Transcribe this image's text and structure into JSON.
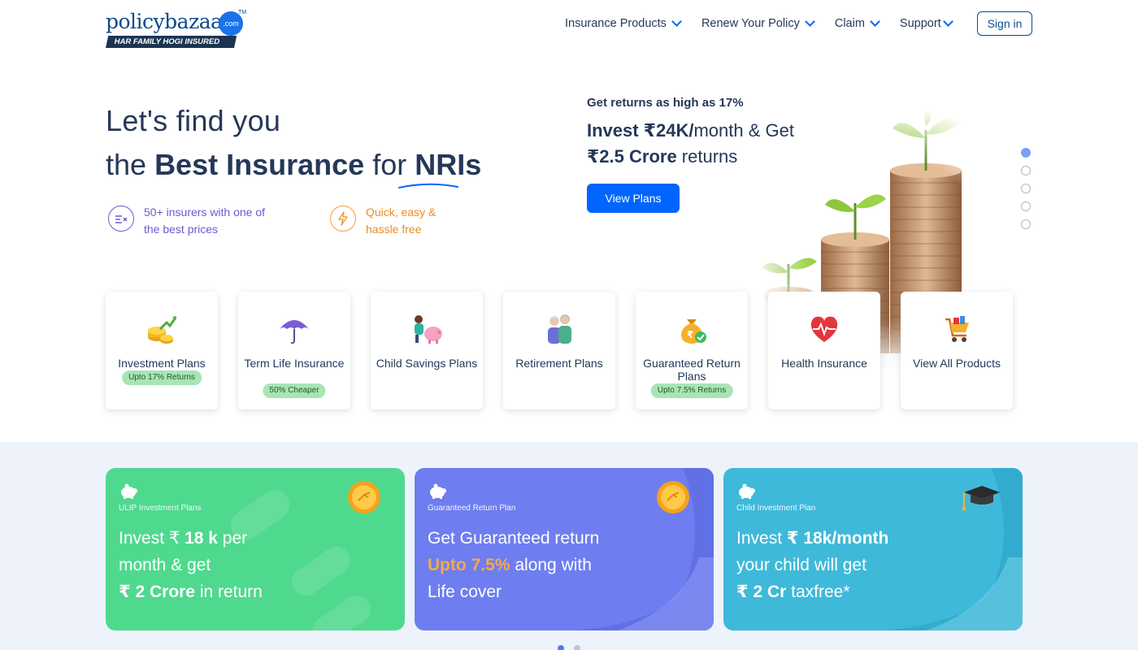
{
  "header": {
    "logo_text": "policybazaar",
    "logo_dot": ".com",
    "logo_tm": "TM",
    "logo_tagline": "HAR FAMILY HOGI INSURED",
    "nav": [
      {
        "label": "Insurance Products"
      },
      {
        "label": "Renew Your Policy"
      },
      {
        "label": "Claim"
      },
      {
        "label": "Support"
      }
    ],
    "signin_label": "Sign in"
  },
  "hero": {
    "title_line1": "Let's find you",
    "title_line2_prefix": "the",
    "title_line2_bold": "Best Insurance",
    "title_line2_mid": "for",
    "title_line2_highlight": "NRIs",
    "features": [
      {
        "text": "50+ insurers with one of the best prices",
        "icon": "compare-icon",
        "color": "#6b5ad1"
      },
      {
        "text": "Quick, easy & hassle free",
        "icon": "lightning-icon",
        "color": "#ea8d25"
      }
    ]
  },
  "promo": {
    "top": "Get returns as high as 17%",
    "line1_bold": "Invest ₹24K/",
    "line1_rest": "month & Get",
    "line2_bold": "₹2.5 Crore",
    "line2_rest": " returns",
    "button_label": "View Plans",
    "slide_count": 5,
    "active_slide": 0
  },
  "products": [
    {
      "label": "Investment Plans",
      "badge": "Upto 17% Returns",
      "icon": "coins-growth-icon"
    },
    {
      "label": "Term Life Insurance",
      "badge": "50% Cheaper",
      "icon": "umbrella-icon"
    },
    {
      "label": "Child Savings Plans",
      "badge": "",
      "icon": "child-piggy-icon"
    },
    {
      "label": "Retirement Plans",
      "badge": "",
      "icon": "elderly-couple-icon"
    },
    {
      "label": "Guaranteed Return Plans",
      "badge": "Upto 7.5% Returns",
      "icon": "money-bag-icon"
    },
    {
      "label": "Health Insurance",
      "badge": "",
      "icon": "heart-pulse-icon"
    },
    {
      "label": "View All Products",
      "badge": "",
      "icon": "cart-icon"
    }
  ],
  "banners": [
    {
      "tag": "ULIP Investment Plans",
      "l1a": "Invest ₹ ",
      "l1b": "18 k",
      "l1c": " per",
      "l2": "month & get",
      "l3a": "₹ 2 Crore",
      "l3b": " in return",
      "color": "#4fd98e"
    },
    {
      "tag": "Guaranteed Return Plan",
      "l1": "Get Guaranteed return",
      "l2a": "Upto 7.5%",
      "l2b": " along with",
      "l3": "Life cover",
      "color": "#6e7ef0"
    },
    {
      "tag": "Child Investment Plan",
      "l1a": "Invest ",
      "l1b": "₹ 18k/month",
      "l2": "your child will get",
      "l3a": "₹ 2 Cr",
      "l3b": " taxfree*",
      "color": "#3fb9d9"
    }
  ],
  "banner_pager": {
    "count": 2,
    "active": 0
  }
}
